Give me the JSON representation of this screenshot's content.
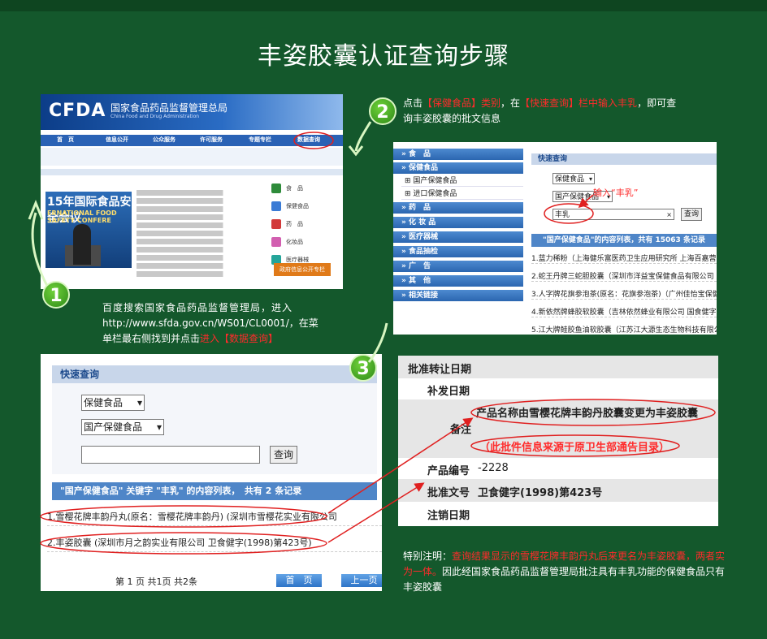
{
  "title": "丰姿胶囊认证查询步骤",
  "step1": {
    "number": "1",
    "text_a": "百度搜索国家食品药品监督管理局，进入",
    "text_b": "http://www.sfda.gov.cn/WS01/CL0001/，在菜",
    "text_c": "单栏最右侧找到并点击",
    "text_red": "进入【数据查询】"
  },
  "step2": {
    "number": "2",
    "t1": "点击",
    "t2_red": "【保健食品】类别",
    "t3": "，在",
    "t4_red": "【快速查询】栏中输入丰乳",
    "t5": "，即可查",
    "t6": "询丰姿胶囊的批文信息"
  },
  "step3": {
    "number": "3"
  },
  "cfda": {
    "logo": "CFDA",
    "name": "国家食品药品监督管理总局",
    "name_en": "China Food and Drug Administration",
    "nav": [
      "首　页",
      "信息公开",
      "公众服务",
      "许可服务",
      "专题专栏",
      "数据查询"
    ],
    "banner_text": "15年国际食品安全会议",
    "banner_en": "ERNATIONAL FOOD SAFETY CONFERE",
    "categories": [
      "食　品",
      "保健食品",
      "药　品",
      "化妆品",
      "医疗器械"
    ],
    "zhengwu": "政府信息公开专栏"
  },
  "panel2": {
    "sidebar": [
      {
        "label": "» 食　品",
        "type": "head"
      },
      {
        "label": "» 保健食品",
        "type": "head"
      },
      {
        "label": "⊞ 国产保健食品",
        "type": "sub"
      },
      {
        "label": "⊞ 进口保健食品",
        "type": "sub"
      },
      {
        "label": "» 药　品",
        "type": "head"
      },
      {
        "label": "» 化 妆 品",
        "type": "head"
      },
      {
        "label": "» 医疗器械",
        "type": "head"
      },
      {
        "label": "» 食品抽检",
        "type": "head"
      },
      {
        "label": "» 广　告",
        "type": "head"
      },
      {
        "label": "» 其　他",
        "type": "head"
      },
      {
        "label": "» 相关链接",
        "type": "head"
      }
    ],
    "quick_search": "快速查询",
    "select1": "保健食品",
    "select2": "国产保健食品",
    "input_value": "丰乳",
    "clear": "×",
    "query_btn": "查询",
    "hint": "输入“丰乳”",
    "list_header": "\"国产保健食品\"的内容列表，共有 15063 条记录",
    "rows": [
      "1.蓝力稀粉（上海健乐富医药卫生应用研究所 上海百嘉营养",
      "2.蛇王丹牌三蛇胆胶囊（深圳市洋益宝保健食品有限公司 卫",
      "3.人字牌花旗参泡茶(原名：花旗参泡茶)（广州佳怡宝保健食",
      "4.新依然牌蜂胶软胶囊（吉林依然蜂业有限公司 国食健字G2",
      "5.江大牌鲑胶鱼油软胶囊（江苏江大源生态生物科技有限公司"
    ]
  },
  "panel3": {
    "quick_search": "快速查询",
    "select1": "保健食品",
    "select2": "国产保健食品",
    "query_btn": "查询",
    "list_header": "\"国产保健食品\" 关键字 \"丰乳\" 的内容列表，　共有 2 条记录",
    "rows": [
      "1.雪樱花牌丰韵丹丸(原名：雪樱花牌丰韵丹) (深圳市雪樱花实业有限公司",
      "2.丰姿胶囊 (深圳市月之韵实业有限公司 卫食健字(1998)第423号)"
    ],
    "pager_text": "第 1 页 共1页 共2条",
    "first_page": "首　页",
    "prev_page": "上一页"
  },
  "panel4": {
    "rows": [
      {
        "label": "批准转让日期",
        "value": ""
      },
      {
        "label": "补发日期",
        "value": ""
      },
      {
        "label": "备注",
        "value": "产品名称由雪樱花牌丰韵丹胶囊变更为丰姿胶囊"
      },
      {
        "label": "",
        "value": "（此批件信息来源于原卫生部通告目录）"
      },
      {
        "label": "产品编号",
        "value": "-2228"
      },
      {
        "label": "批准文号",
        "value": "卫食健字(1998)第423号"
      },
      {
        "label": "注销日期",
        "value": ""
      }
    ]
  },
  "note": {
    "prefix": "特别注明：",
    "red": "查询结果显示的雪樱花牌丰韵丹丸后来更名为丰姿胶囊，两者实为一体。",
    "rest": "因此经国家食品药品监督管理局批注具有丰乳功能的保健食品只有丰姿胶囊"
  }
}
